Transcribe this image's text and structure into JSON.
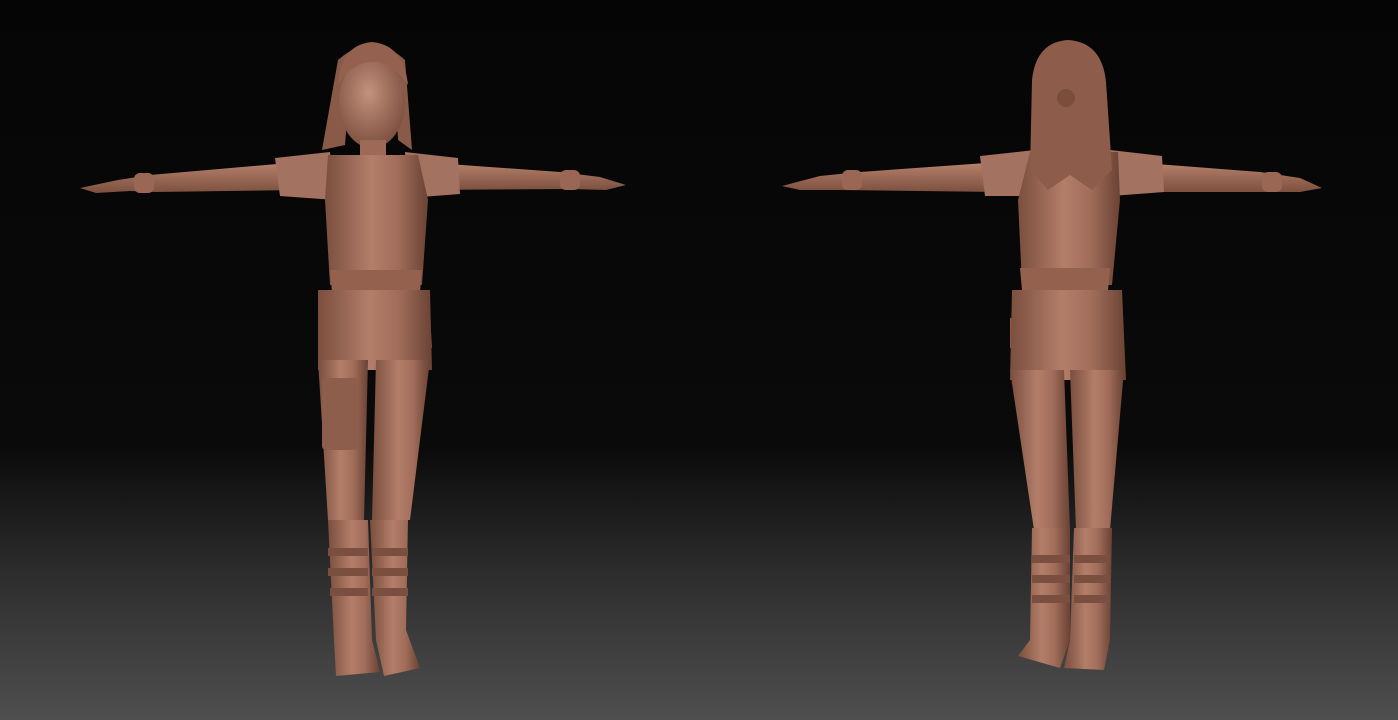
{
  "scene": {
    "subject": "3d-sculpt-female-character-t-pose",
    "views": [
      {
        "name": "front-view"
      },
      {
        "name": "back-view"
      }
    ],
    "colors": {
      "clay": "#a9735f",
      "clay_dark": "#6e4638",
      "clay_light": "#c4917c",
      "background_top": "#050505",
      "background_bottom": "#4f4f4f"
    }
  }
}
